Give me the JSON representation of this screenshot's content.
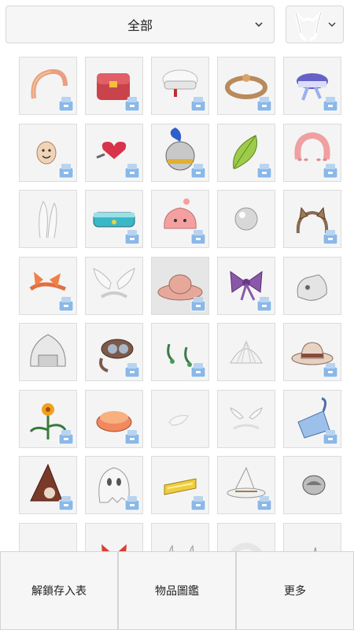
{
  "filter": {
    "selected": "全部",
    "chevron_icon": "chevron-down-icon"
  },
  "type_filter": {
    "icon": "cat-ears-headgear-icon",
    "chevron_icon": "chevron-down-icon"
  },
  "items": [
    {
      "icon": "halo-headband-icon",
      "stored": true
    },
    {
      "icon": "red-satchel-icon",
      "stored": true
    },
    {
      "icon": "white-sailor-cap-icon",
      "stored": true
    },
    {
      "icon": "brown-headband-icon",
      "stored": true
    },
    {
      "icon": "purple-ribbon-hat-icon",
      "stored": true
    },
    {
      "icon": "smiley-mask-icon",
      "stored": true
    },
    {
      "icon": "red-heart-clip-icon",
      "stored": true
    },
    {
      "icon": "knight-helmet-icon",
      "stored": true
    },
    {
      "icon": "green-leaf-icon",
      "stored": true
    },
    {
      "icon": "pink-wig-icon",
      "stored": true
    },
    {
      "icon": "white-bunny-ears-icon",
      "stored": false
    },
    {
      "icon": "teal-crown-icon",
      "stored": true
    },
    {
      "icon": "pink-poring-hat-icon",
      "stored": true
    },
    {
      "icon": "grey-orb-icon",
      "stored": false
    },
    {
      "icon": "cat-ears-headband-icon",
      "stored": true
    },
    {
      "icon": "orange-bow-headband-icon",
      "stored": true
    },
    {
      "icon": "white-wings-headband-icon",
      "stored": false
    },
    {
      "icon": "pink-sun-hat-icon",
      "stored": true
    },
    {
      "icon": "purple-bow-icon",
      "stored": true
    },
    {
      "icon": "silver-mask-icon",
      "stored": false
    },
    {
      "icon": "silver-helm-icon",
      "stored": false
    },
    {
      "icon": "goggles-icon",
      "stored": true
    },
    {
      "icon": "green-earrings-icon",
      "stored": true
    },
    {
      "icon": "white-shell-icon",
      "stored": false
    },
    {
      "icon": "cowboy-hat-icon",
      "stored": true
    },
    {
      "icon": "flower-plant-icon",
      "stored": true
    },
    {
      "icon": "orange-cushion-icon",
      "stored": true
    },
    {
      "icon": "white-drop-icon",
      "stored": false
    },
    {
      "icon": "wing-headband-icon",
      "stored": false
    },
    {
      "icon": "blue-bag-icon",
      "stored": true
    },
    {
      "icon": "skull-hood-icon",
      "stored": true
    },
    {
      "icon": "ghost-mask-icon",
      "stored": true
    },
    {
      "icon": "gold-band-icon",
      "stored": true
    },
    {
      "icon": "witch-hat-icon",
      "stored": true
    },
    {
      "icon": "silver-ornament-icon",
      "stored": false
    },
    {
      "icon": "white-shell-hat-icon",
      "stored": false
    },
    {
      "icon": "red-bow-icon",
      "stored": false
    },
    {
      "icon": "horn-pair-icon",
      "stored": false
    },
    {
      "icon": "white-wreath-icon",
      "stored": false
    },
    {
      "icon": "grey-horn-icon",
      "stored": false
    }
  ],
  "actions": {
    "unlock_storage": "解鎖存入表",
    "item_encyclopedia": "物品圖鑑",
    "more": "更多"
  },
  "colors": {
    "cell_bg": "#f4f4f4",
    "cell_border": "#dcdcdc",
    "badge_blue": "#7fb3e6",
    "bar_bg": "#f6f6f6"
  }
}
